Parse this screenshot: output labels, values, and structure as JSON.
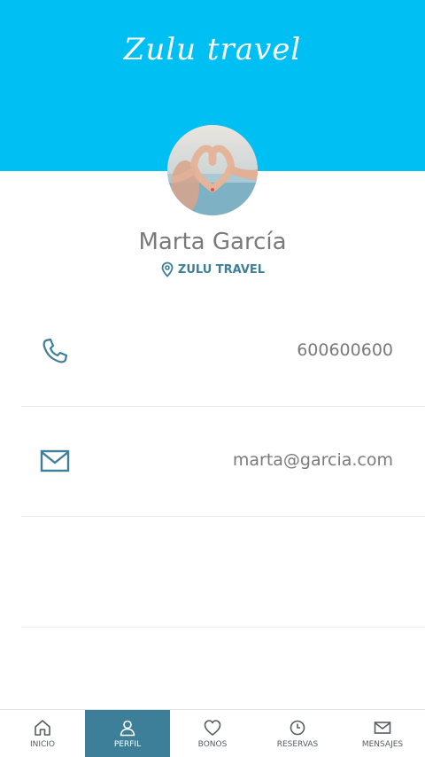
{
  "header": {
    "brand": "Zulu travel",
    "background": "#00bff3"
  },
  "profile": {
    "name": "Marta García",
    "company": "ZULU TRAVEL",
    "company_icon": "location-pin-icon"
  },
  "contacts": [
    {
      "icon": "phone-icon",
      "value": "600600600"
    },
    {
      "icon": "mail-icon",
      "value": "marta@garcia.com"
    }
  ],
  "tabs": [
    {
      "icon": "home-icon",
      "label": "INICIO",
      "active": false
    },
    {
      "icon": "user-icon",
      "label": "PERFIL",
      "active": true
    },
    {
      "icon": "heart-icon",
      "label": "BONOS",
      "active": false
    },
    {
      "icon": "clock-icon",
      "label": "RESERVAS",
      "active": false
    },
    {
      "icon": "mail-icon",
      "label": "MENSAJES",
      "active": false
    }
  ],
  "colors": {
    "accent": "#3d7f98",
    "text_gray": "#7a7a7a"
  }
}
